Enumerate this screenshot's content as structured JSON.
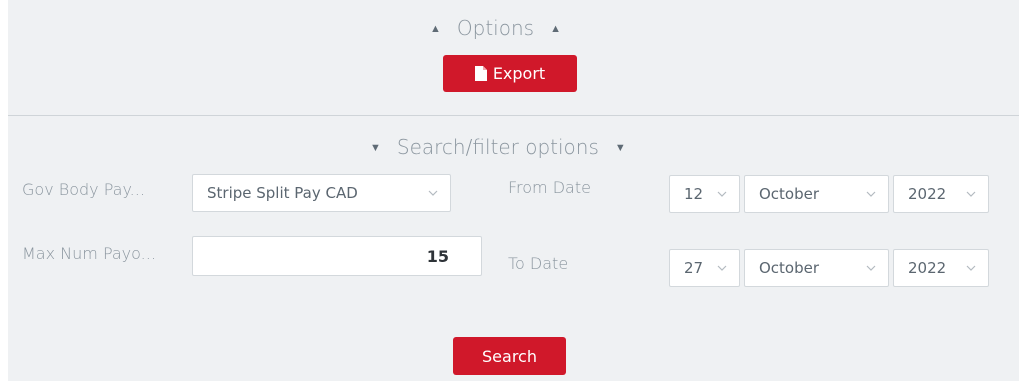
{
  "options": {
    "label": "Options",
    "export_label": "Export"
  },
  "filters": {
    "toggle_label": "Search/filter options",
    "gov_body": {
      "label": "Gov Body Pay...",
      "value": "Stripe Split Pay CAD"
    },
    "max_num": {
      "label": "Max Num Payo...",
      "value": "15"
    },
    "from_date": {
      "label": "From Date",
      "day": "12",
      "month": "October",
      "year": "2022"
    },
    "to_date": {
      "label": "To Date",
      "day": "27",
      "month": "October",
      "year": "2022"
    },
    "search_label": "Search"
  },
  "colors": {
    "accent": "#d0182a",
    "background": "#eff1f3",
    "label": "#8a959e"
  },
  "icons": {
    "toggle": "caret-triangle-icon",
    "export": "file-icon",
    "select": "chevron-down-icon"
  }
}
